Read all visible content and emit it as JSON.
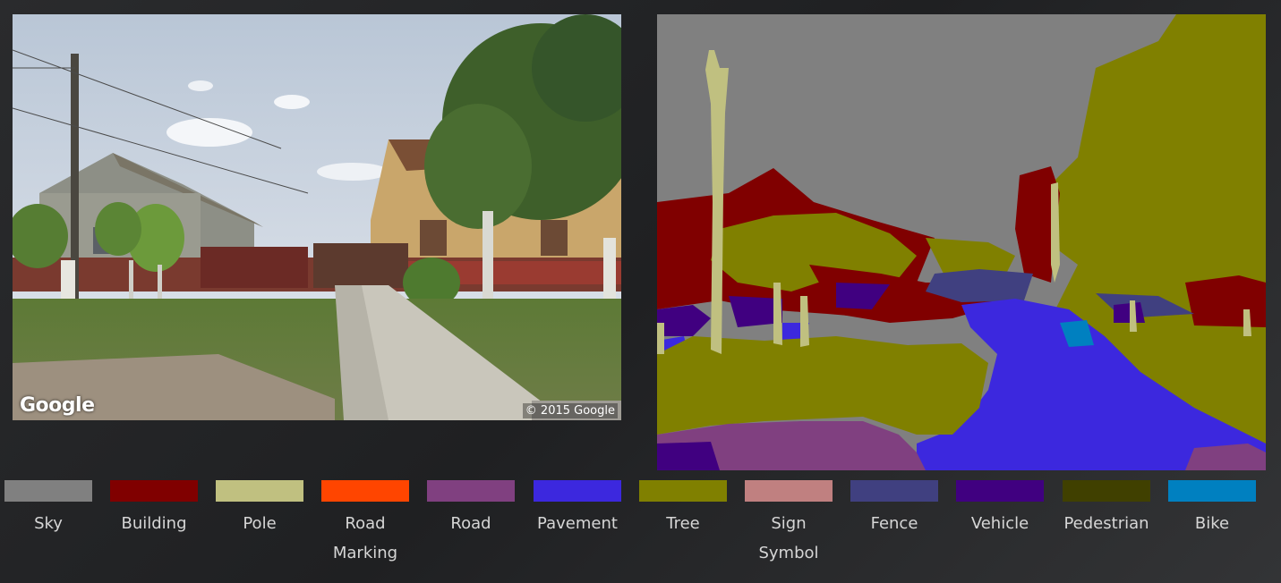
{
  "photo": {
    "watermark_logo": "Google",
    "watermark_copyright": "© 2015 Google"
  },
  "legend": {
    "items": [
      {
        "label": "Sky",
        "color": "#808080"
      },
      {
        "label": "Building",
        "color": "#800000"
      },
      {
        "label": "Pole",
        "color": "#c0c080"
      },
      {
        "label": "Road Marking",
        "color": "#ff4500"
      },
      {
        "label": "Road",
        "color": "#804080"
      },
      {
        "label": "Pavement",
        "color": "#3c28de"
      },
      {
        "label": "Tree",
        "color": "#808000"
      },
      {
        "label": "Sign Symbol",
        "color": "#c08080"
      },
      {
        "label": "Fence",
        "color": "#404080"
      },
      {
        "label": "Vehicle",
        "color": "#400080"
      },
      {
        "label": "Pedestrian",
        "color": "#404000"
      },
      {
        "label": "Bike",
        "color": "#0080c0"
      }
    ]
  }
}
